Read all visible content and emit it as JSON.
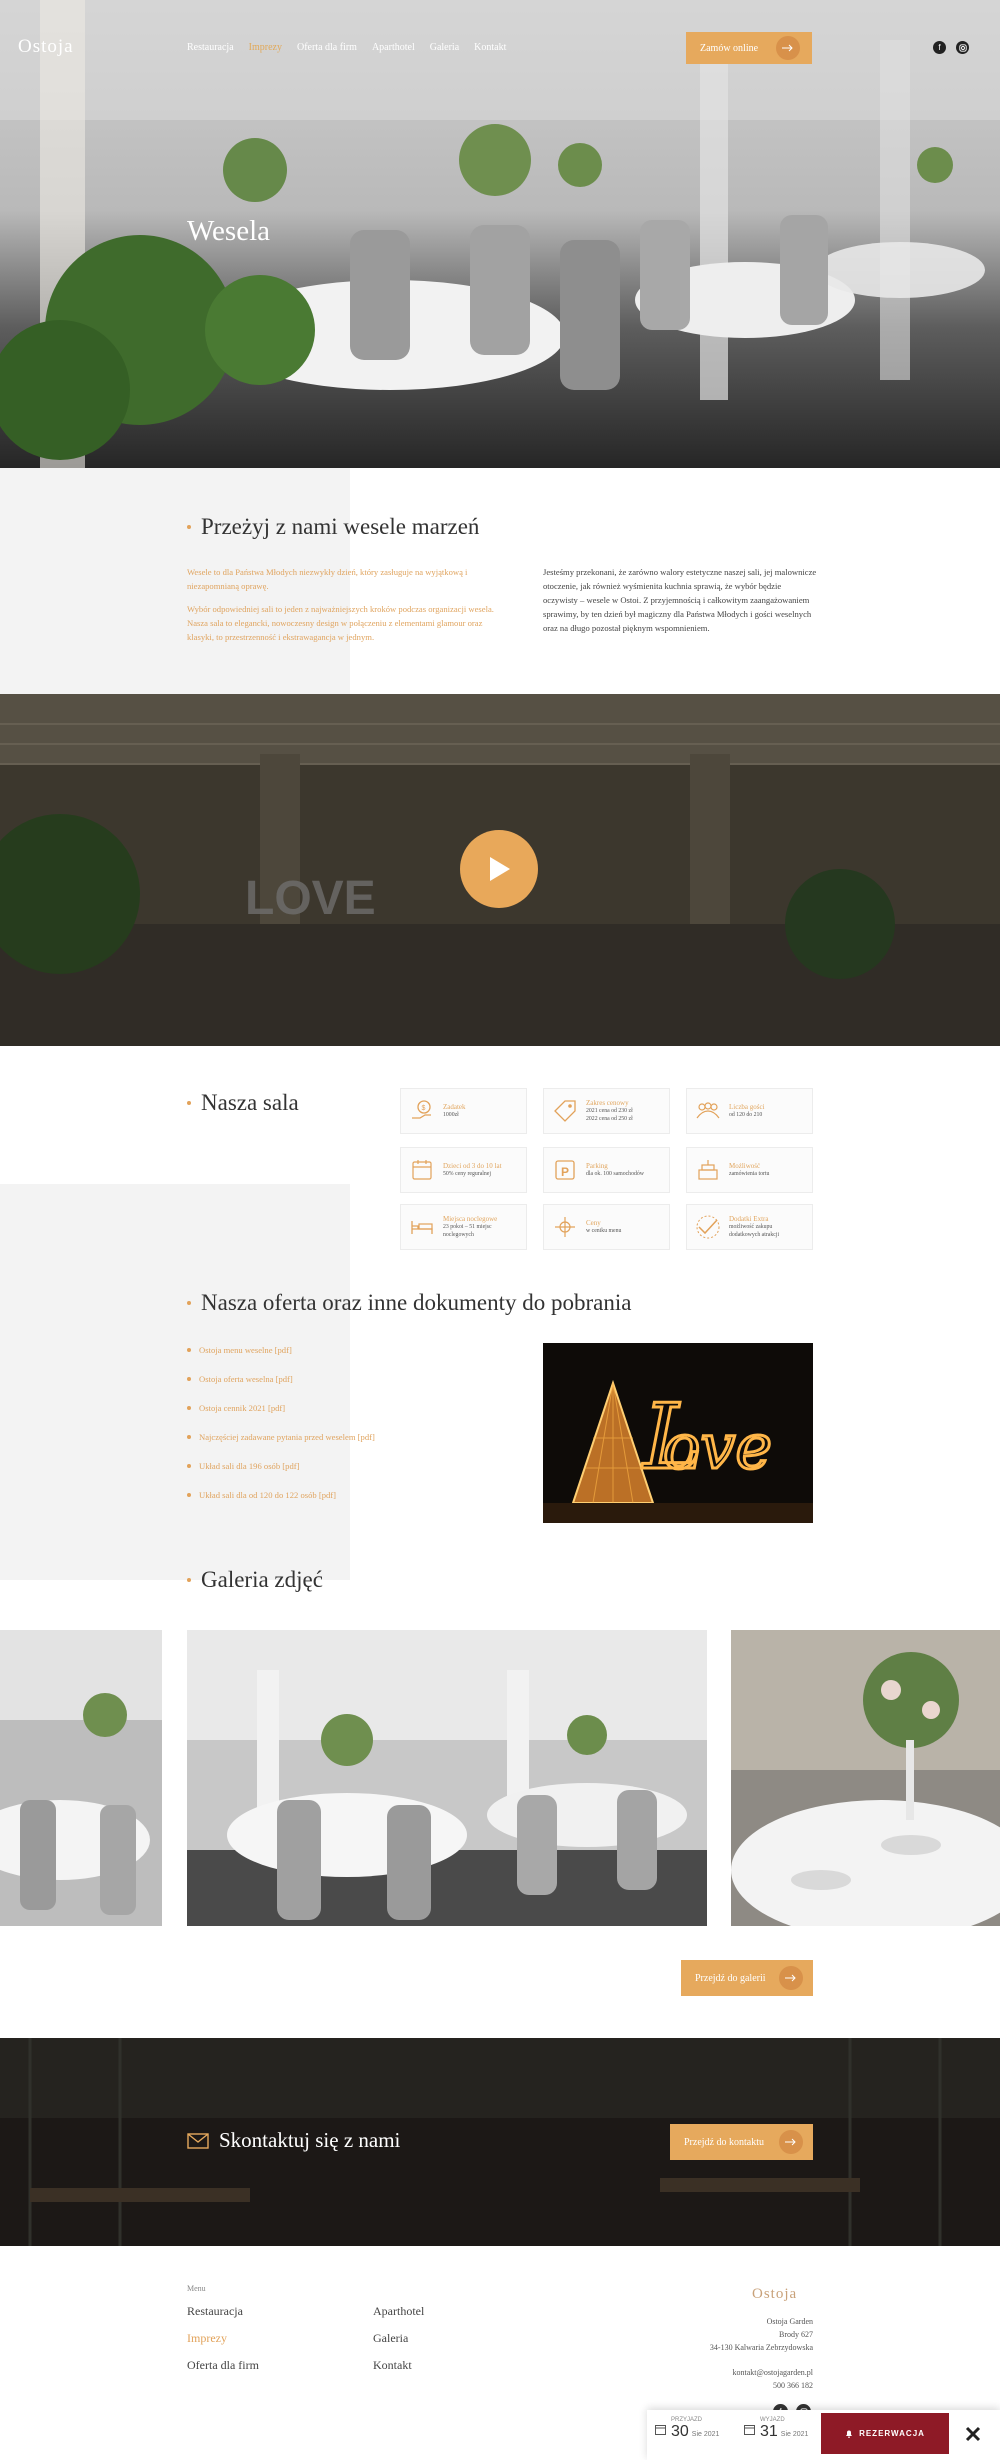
{
  "brand": {
    "logo_text": "Ostoja",
    "colors": {
      "gold": "#e6a95d",
      "burgundy": "#8e1a26",
      "gray_panel": "#f3f3f3"
    }
  },
  "nav": {
    "items": [
      {
        "label": "Restauracja",
        "active": false
      },
      {
        "label": "Imprezy",
        "active": true
      },
      {
        "label": "Oferta dla firm",
        "active": false
      },
      {
        "label": "Aparthotel",
        "active": false
      },
      {
        "label": "Galeria",
        "active": false
      },
      {
        "label": "Kontakt",
        "active": false
      }
    ],
    "cta_label": "Zamów online",
    "social": [
      "facebook-icon",
      "instagram-icon"
    ]
  },
  "hero": {
    "title": "Wesela"
  },
  "intro": {
    "heading": "Przeżyj z nami wesele marzeń",
    "left_p1": "Wesele to dla Państwa Młodych niezwykły dzień, który zasługuje na wyjątkową i niezapomnianą oprawę.",
    "left_p2": "Wybór odpowiedniej sali to jeden z najważniejszych kroków podczas organizacji wesela. Nasza sala to elegancki, nowoczesny design w połączeniu z elementami glamour oraz klasyki, to przestrzenność i ekstrawagancja w jednym.",
    "right_p": "Jesteśmy przekonani, że zarówno walory estetyczne naszej sali, jej malownicze otoczenie, jak również wyśmienita kuchnia sprawią, że wybór będzie oczywisty – wesele w Ostoi. Z przyjemnością i całkowitym zaangażowaniem sprawimy, by ten dzień był magiczny dla Państwa Młodych i gości weselnych oraz na długo pozostał pięknym wspomnieniem."
  },
  "video": {
    "play_label": "play-icon"
  },
  "hall": {
    "heading": "Nasza sala",
    "amenities": [
      {
        "icon": "deposit-icon",
        "title": "Zadatek",
        "desc": "1000zł"
      },
      {
        "icon": "tag-icon",
        "title": "Zakres cenowy",
        "desc": "2021 cena od 230 zł\n2022 cena od 250 zł"
      },
      {
        "icon": "guests-icon",
        "title": "Liczba gości",
        "desc": "od 120 do 210"
      },
      {
        "icon": "calendar-icon",
        "title": "Dzieci od 3 do 10 lat",
        "desc": "50% ceny reguralnej"
      },
      {
        "icon": "parking-icon",
        "title": "Parking",
        "desc": "dla ok. 100 samochodów"
      },
      {
        "icon": "cake-icon",
        "title": "Możliwość",
        "desc": "zamówienia tortu"
      },
      {
        "icon": "bed-icon",
        "title": "Miejsca noclegowe",
        "desc": "23 pokoi – 51 miejsc noclegowych"
      },
      {
        "icon": "price-icon",
        "title": "Ceny",
        "desc": "w ceniku menu"
      },
      {
        "icon": "check-icon",
        "title": "Dodatki Extra",
        "desc": "możliwość zakupu dodatkowych atrakcji"
      }
    ]
  },
  "docs": {
    "heading": "Nasza oferta oraz inne dokumenty do pobrania",
    "items": [
      "Ostoja menu weselne [pdf]",
      "Ostoja oferta weselna [pdf]",
      "Ostoja cennik 2021 [pdf]",
      "Najczęściej zadawane pytania przed weselem [pdf]",
      "Układ sali dla 196 osób [pdf]",
      "Układ sali dla od 120 do 122 osób [pdf]"
    ]
  },
  "gallery": {
    "heading": "Galeria zdjęć",
    "button_label": "Przejdź do galerii"
  },
  "contact": {
    "heading": "Skontaktuj się z nami",
    "button_label": "Przejdź do kontaktu"
  },
  "footer": {
    "menu_label": "Menu",
    "col1": [
      "Restauracja",
      "Imprezy",
      "Oferta dla firm"
    ],
    "col2": [
      "Aparthotel",
      "Galeria",
      "Kontakt"
    ],
    "address": [
      "Ostoja Garden",
      "Brody 627",
      "34-130 Kalwaria Zebrzydowska"
    ],
    "email": "kontakt@ostojagarden.pl",
    "phone": "500 366 182"
  },
  "booking": {
    "arrival_label": "PRZYJAZD",
    "arrival_day": "30",
    "arrival_rest": "Sie 2021",
    "departure_label": "WYJAZD",
    "departure_day": "31",
    "departure_rest": "Sie 2021",
    "button_label": "REZERWACJA"
  }
}
